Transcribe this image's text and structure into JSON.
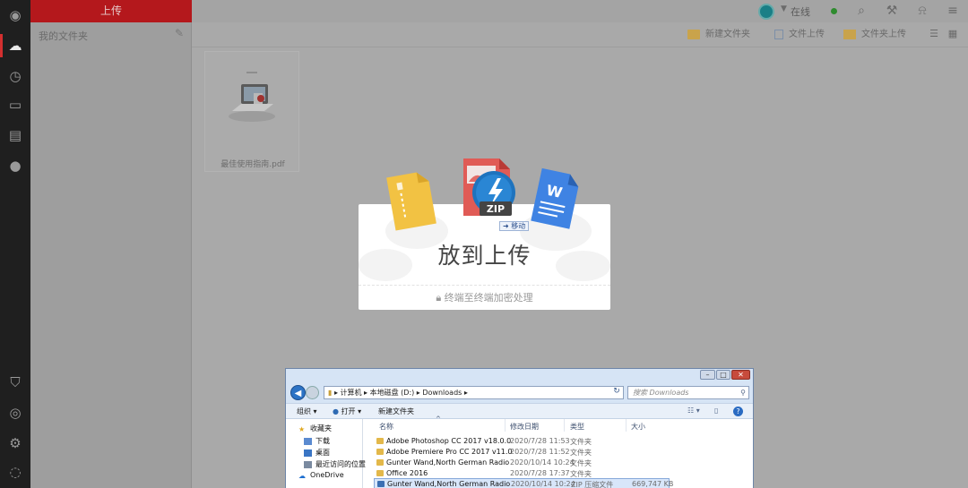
{
  "sidebar": {
    "upload_label": "上传",
    "section_title": "我的文件夹",
    "rail_icons": [
      "logo-icon",
      "cloud-icon",
      "clock-icon",
      "message-icon",
      "contacts-icon",
      "chat-icon",
      "security-icon",
      "help-icon",
      "settings-icon",
      "info-icon"
    ]
  },
  "header": {
    "user_status": "在线",
    "icons": [
      "search-icon",
      "tools-icon",
      "notification-icon",
      "menu-icon"
    ]
  },
  "toolbar": {
    "new_folder": "新建文件夹",
    "upload_file": "文件上传",
    "upload_folder": "文件夹上传"
  },
  "file_card": {
    "name": "最佳使用指南.pdf"
  },
  "dropzone": {
    "title": "放到上传",
    "subtitle": "终端至终端加密处理",
    "zip_label": "ZIP",
    "word_label": "W",
    "move_label": "移动"
  },
  "explorer": {
    "path": [
      "计算机",
      "本地磁盘 (D:)",
      "Downloads"
    ],
    "search_placeholder": "搜索 Downloads",
    "commands": {
      "organize": "组织",
      "open": "打开",
      "new_folder": "新建文件夹"
    },
    "nav": [
      {
        "label": "收藏夹",
        "icon": "star-icon"
      },
      {
        "label": "下载",
        "icon": "download-icon"
      },
      {
        "label": "桌面",
        "icon": "desktop-icon"
      },
      {
        "label": "最近访问的位置",
        "icon": "recent-icon"
      },
      {
        "label": "OneDrive",
        "icon": "onedrive-icon"
      }
    ],
    "columns": {
      "name": "名称",
      "date": "修改日期",
      "type": "类型",
      "size": "大小"
    },
    "rows": [
      {
        "name": "Adobe Photoshop CC 2017 v18.0.0 ...",
        "date": "2020/7/28 11:53",
        "type": "文件夹",
        "size": ""
      },
      {
        "name": "Adobe Premiere Pro CC 2017 v11.0 ...",
        "date": "2020/7/28 11:52",
        "type": "文件夹",
        "size": ""
      },
      {
        "name": "Gunter Wand,North German Radio S...",
        "date": "2020/10/14 10:24",
        "type": "文件夹",
        "size": ""
      },
      {
        "name": "Office 2016",
        "date": "2020/7/28 17:37",
        "type": "文件夹",
        "size": ""
      },
      {
        "name": "Gunter Wand,North German Radio S...",
        "date": "2020/10/14 10:24",
        "type": "ZIP 压缩文件",
        "size": "669,747 KB"
      }
    ]
  },
  "colors": {
    "accent": "#b4181c",
    "rail": "#1f1f1f",
    "status_online": "#2e8b2e"
  }
}
